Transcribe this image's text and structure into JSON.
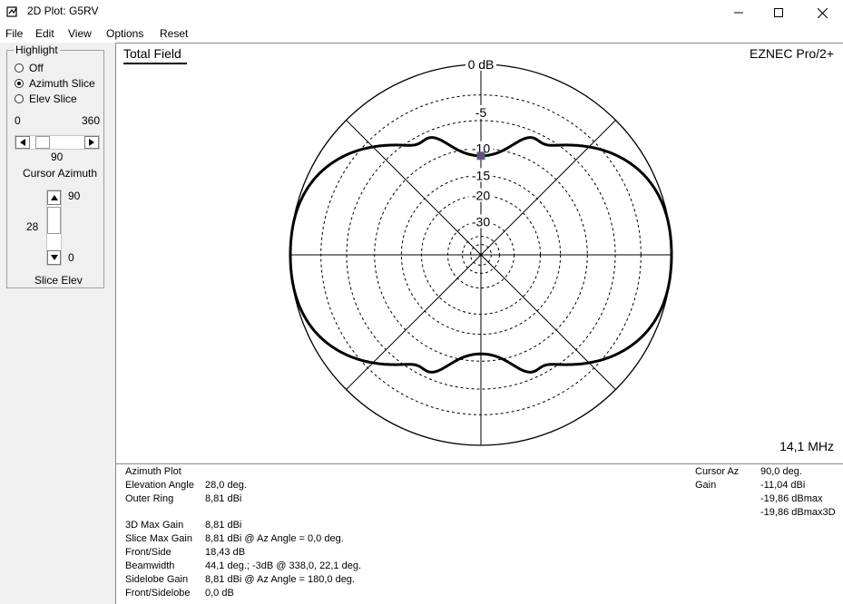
{
  "window": {
    "title": "2D Plot: G5RV"
  },
  "menu": [
    "File",
    "Edit",
    "View",
    "Options",
    "Reset"
  ],
  "highlight": {
    "title": "Highlight",
    "options": [
      {
        "label": "Off",
        "selected": false
      },
      {
        "label": "Azimuth Slice",
        "selected": true
      },
      {
        "label": "Elev Slice",
        "selected": false
      }
    ]
  },
  "azimuth_control": {
    "min": "0",
    "max": "360",
    "value": "90",
    "label": "Cursor Azimuth"
  },
  "elev_control": {
    "max": "90",
    "min": "0",
    "value": "28",
    "label": "Slice Elev"
  },
  "plot": {
    "title": "Total Field",
    "brand": "EZNEC Pro/2+",
    "frequency": "14,1 MHz",
    "ring_labels": [
      "0 dB",
      "-5",
      "-10",
      "-15",
      "-20",
      "-30"
    ],
    "line_color": "#000000",
    "cursor_color": "#7b3fa0"
  },
  "chart_data": {
    "type": "polar",
    "title": "Total Field",
    "angle_unit": "deg",
    "radial_unit": "dB relative to outer ring",
    "outer_ring_dbi": 8.81,
    "ring_labels": [
      "0 dB",
      "-5",
      "-10",
      "-15",
      "-20",
      "-30"
    ],
    "series": [
      {
        "name": "",
        "azimuth": [
          0,
          15,
          30,
          45,
          60,
          75,
          90,
          105,
          120,
          135,
          150,
          165,
          180,
          195,
          210,
          225,
          240,
          255,
          270,
          285,
          300,
          315,
          330,
          345,
          360
        ],
        "db": [
          0,
          -0.5,
          -2,
          -4.5,
          -8.2,
          -11.2,
          -11.04,
          -11.2,
          -8.2,
          -4.5,
          -2,
          -0.5,
          0,
          -0.5,
          -2,
          -4.5,
          -8.2,
          -11.2,
          -11.04,
          -11.2,
          -8.2,
          -4.5,
          -2,
          -0.5,
          0
        ]
      }
    ],
    "cursor_azimuth": 90
  },
  "info": {
    "left": [
      {
        "label": "Azimuth Plot",
        "value": ""
      },
      {
        "label": "Elevation Angle",
        "value": "28,0 deg."
      },
      {
        "label": "Outer Ring",
        "value": "8,81 dBi"
      },
      {
        "label": "3D Max Gain",
        "value": "8,81 dBi"
      },
      {
        "label": "Slice Max Gain",
        "value": "8,81 dBi @ Az Angle = 0,0 deg."
      },
      {
        "label": "Front/Side",
        "value": "18,43 dB"
      },
      {
        "label": "Beamwidth",
        "value": "44,1 deg.; -3dB @ 338,0, 22,1 deg."
      },
      {
        "label": "Sidelobe Gain",
        "value": "8,81 dBi @ Az Angle = 180,0 deg."
      },
      {
        "label": "Front/Sidelobe",
        "value": "0,0 dB"
      }
    ],
    "right": [
      {
        "label": "Cursor Az",
        "value": "90,0 deg."
      },
      {
        "label": "Gain",
        "value": "-11,04 dBi"
      },
      {
        "label": "",
        "value": "-19,86 dBmax"
      },
      {
        "label": "",
        "value": "-19,86 dBmax3D"
      }
    ]
  }
}
